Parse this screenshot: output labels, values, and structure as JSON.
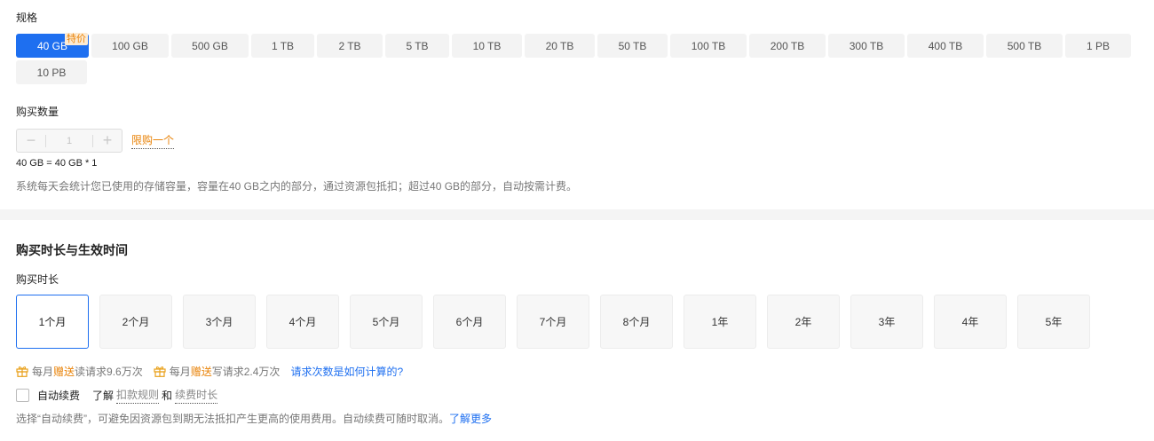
{
  "spec": {
    "label": "规格",
    "options": [
      {
        "text": "40 GB",
        "badge": "特价",
        "selected": true
      },
      {
        "text": "100 GB"
      },
      {
        "text": "500 GB"
      },
      {
        "text": "1 TB"
      },
      {
        "text": "2 TB"
      },
      {
        "text": "5 TB"
      },
      {
        "text": "10 TB"
      },
      {
        "text": "20 TB"
      },
      {
        "text": "50 TB"
      },
      {
        "text": "100 TB"
      },
      {
        "text": "200 TB"
      },
      {
        "text": "300 TB"
      },
      {
        "text": "400 TB"
      },
      {
        "text": "500 TB"
      },
      {
        "text": "1 PB"
      },
      {
        "text": "10 PB"
      }
    ]
  },
  "quantity": {
    "label": "购买数量",
    "minus": "−",
    "value": "1",
    "plus": "+",
    "limit": "限购一个",
    "formula": "40 GB = 40 GB * 1",
    "note": "系统每天会统计您已使用的存储容量，容量在40 GB之内的部分，通过资源包抵扣；超过40 GB的部分，自动按需计费。"
  },
  "duration": {
    "section_title": "购买时长与生效时间",
    "label": "购买时长",
    "options": [
      {
        "text": "1个月",
        "selected": true
      },
      {
        "text": "2个月"
      },
      {
        "text": "3个月"
      },
      {
        "text": "4个月"
      },
      {
        "text": "5个月"
      },
      {
        "text": "6个月"
      },
      {
        "text": "7个月"
      },
      {
        "text": "8个月"
      },
      {
        "text": "1年"
      },
      {
        "text": "2年"
      },
      {
        "text": "3年"
      },
      {
        "text": "4年"
      },
      {
        "text": "5年"
      }
    ]
  },
  "gifts": {
    "read": {
      "prefix": "每月",
      "highlight": "赠送",
      "suffix": "读请求9.6万次"
    },
    "write": {
      "prefix": "每月",
      "highlight": "赠送",
      "suffix": "写请求2.4万次"
    },
    "link": "请求次数是如何计算的?"
  },
  "renew": {
    "checkbox_label": "自动续费",
    "learn": "了解",
    "rule_link": "扣款规则",
    "and": "和",
    "period_link": "续费时长",
    "note": "选择“自动续费”，可避免因资源包到期无法抵扣产生更高的使用费用。自动续费可随时取消。",
    "more_link": "了解更多"
  },
  "colors": {
    "accent": "#1e6ff0",
    "highlight": "#e9840b"
  },
  "icons": {
    "gift": "gift-icon"
  }
}
